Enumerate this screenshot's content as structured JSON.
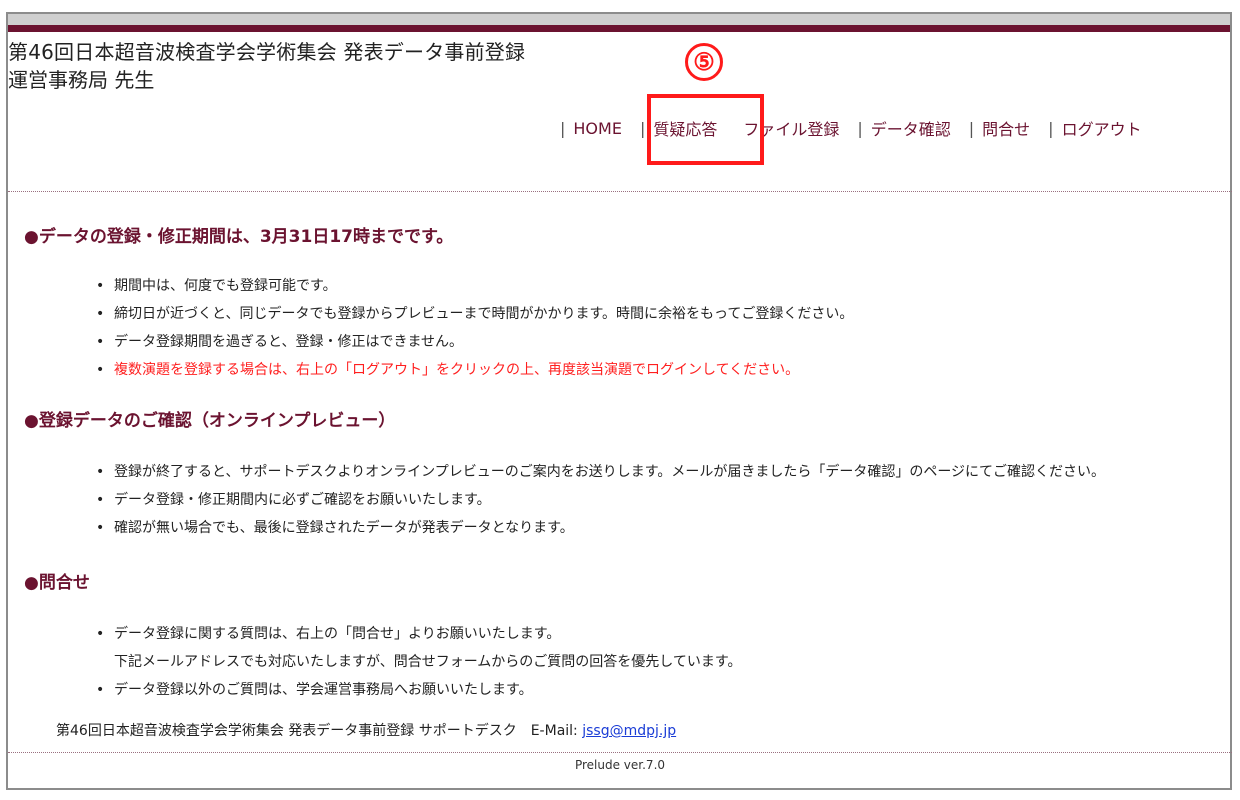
{
  "header": {
    "site_title": "第46回日本超音波検査学会学術集会 発表データ事前登録",
    "user_name": "運営事務局 先生"
  },
  "nav": {
    "items": [
      "HOME",
      "質疑応答",
      "ファイル登録",
      "データ確認",
      "問合せ",
      "ログアウト"
    ]
  },
  "annotation": {
    "number": "⑤",
    "color": "#ff1a1a"
  },
  "sections": [
    {
      "title": "●データの登録・修正期間は、3月31日17時までです。",
      "bullets": [
        "期間中は、何度でも登録可能です。",
        "締切日が近づくと、同じデータでも登録からプレビューまで時間がかかります。時間に余裕をもってご登録ください。",
        "データ登録期間を過ぎると、登録・修正はできません。",
        "複数演題を登録する場合は、右上の「ログアウト」をクリックの上、再度該当演題でログインしてください。"
      ]
    },
    {
      "title": "●登録データのご確認（オンラインプレビュー）",
      "bullets": [
        "登録が終了すると、サポートデスクよりオンラインプレビューのご案内をお送りします。メールが届きましたら「データ確認」のページにてご確認ください。",
        "データ登録・修正期間内に必ずご確認をお願いいたします。",
        "確認が無い場合でも、最後に登録されたデータが発表データとなります。"
      ]
    },
    {
      "title": "●問合せ",
      "bullets": [
        "データ登録に関する質問は、右上の「問合せ」よりお願いいたします。",
        "下記メールアドレスでも対応いたしますが、問合せフォームからのご質問の回答を優先しています。",
        "データ登録以外のご質問は、学会運営事務局へお願いいたします。"
      ]
    }
  ],
  "footer": {
    "support_text": "第46回日本超音波検査学会学術集会 発表データ事前登録 サポートデスク　E-Mail: ",
    "email": "jssg@mdpj.jp",
    "version": "Prelude ver.7.0"
  },
  "colors": {
    "accent": "#6b1330",
    "warning_text": "#ff1f1f",
    "link": "#1a3cd6"
  }
}
